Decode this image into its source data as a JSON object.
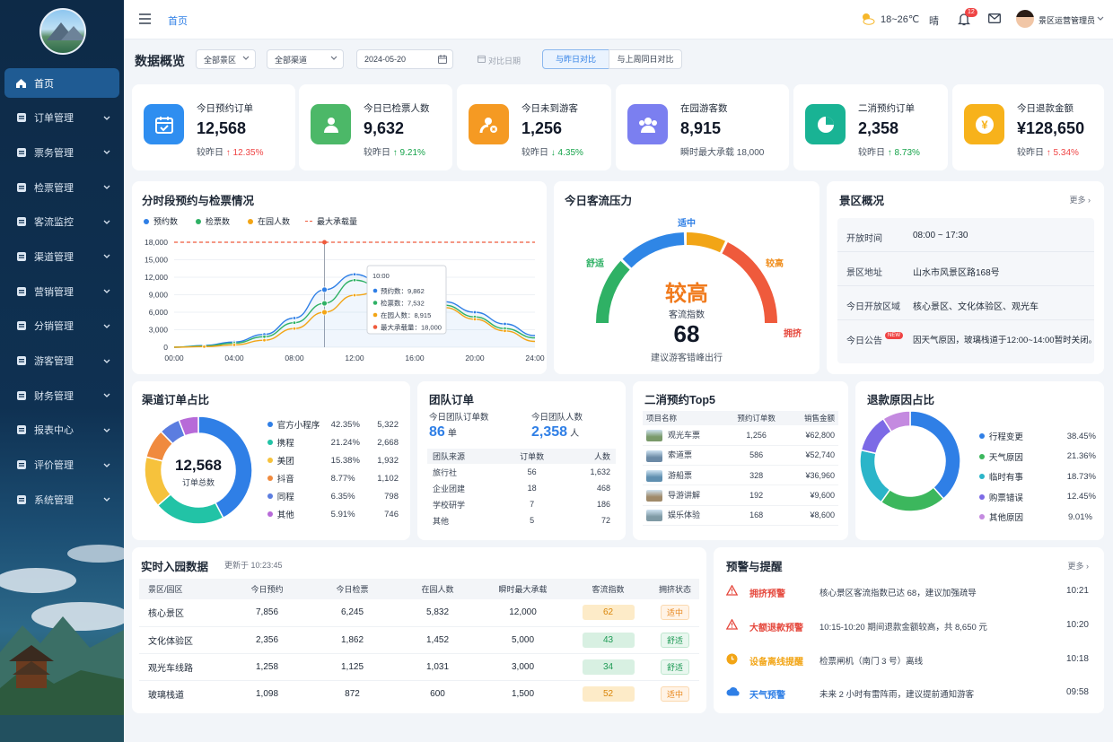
{
  "nav": {
    "items": [
      {
        "label": "首页",
        "icon": "home-icon"
      },
      {
        "label": "订单管理",
        "icon": "order-icon"
      },
      {
        "label": "票务管理",
        "icon": "ticket-icon"
      },
      {
        "label": "检票管理",
        "icon": "checkin-icon"
      },
      {
        "label": "客流监控",
        "icon": "monitor-icon"
      },
      {
        "label": "渠道管理",
        "icon": "channel-icon"
      },
      {
        "label": "营销管理",
        "icon": "marketing-icon"
      },
      {
        "label": "分销管理",
        "icon": "distribution-icon"
      },
      {
        "label": "游客管理",
        "icon": "visitor-icon"
      },
      {
        "label": "财务管理",
        "icon": "finance-icon"
      },
      {
        "label": "报表中心",
        "icon": "report-icon"
      },
      {
        "label": "评价管理",
        "icon": "review-icon"
      },
      {
        "label": "系统管理",
        "icon": "settings-icon"
      }
    ]
  },
  "topbar": {
    "breadcrumb": "首页",
    "weather_temp": "18~26℃",
    "weather_text": "晴",
    "notif_count": "12",
    "user_name": "景区运营管理员"
  },
  "filters": {
    "title": "数据概览",
    "scenic": "全部景区",
    "channel": "全部渠道",
    "date": "2024-05-20",
    "compare_date": "对比日期",
    "btn_yesterday": "与昨日对比",
    "btn_lastweek": "与上周同日对比"
  },
  "kpis": [
    {
      "label": "今日预约订单",
      "value": "12,568",
      "cmp_label": "较昨日",
      "cmp": "↑ 12.35%",
      "dir": "up",
      "color": "#2f8ef0"
    },
    {
      "label": "今日已检票人数",
      "value": "9,632",
      "cmp_label": "较昨日",
      "cmp": "↑ 9.21%",
      "dir": "dn",
      "color": "#4cb868"
    },
    {
      "label": "今日未到游客",
      "value": "1,256",
      "cmp_label": "较昨日",
      "cmp": "↓ 4.35%",
      "dir": "dn",
      "color": "#f59a23"
    },
    {
      "label": "在园游客数",
      "value": "8,915",
      "cmp_label": "瞬时最大承载",
      "cmp": "18,000",
      "dir": "none",
      "color": "#7b7ff0"
    },
    {
      "label": "二消预约订单",
      "value": "2,358",
      "cmp_label": "较昨日",
      "cmp": "↑ 8.73%",
      "dir": "dn",
      "color": "#19b394"
    },
    {
      "label": "今日退款金额",
      "value": "¥128,650",
      "cmp_label": "较昨日",
      "cmp": "↑ 5.34%",
      "dir": "up",
      "color": "#f7b21b"
    }
  ],
  "hourly": {
    "title": "分时段预约与检票情况",
    "legend": [
      "预约数",
      "检票数",
      "在园人数",
      "最大承载量"
    ],
    "tooltip": {
      "time": "10:00",
      "rows": [
        "预约数：9,862",
        "检票数：7,532",
        "在园人数：8,915",
        "最大承载量：18,000"
      ]
    }
  },
  "chart_data": {
    "type": "line",
    "x": [
      "00:00",
      "02:00",
      "04:00",
      "06:00",
      "08:00",
      "10:00",
      "12:00",
      "14:00",
      "16:00",
      "18:00",
      "20:00",
      "22:00",
      "24:00"
    ],
    "series": [
      {
        "name": "预约数",
        "values": [
          0,
          300,
          900,
          2200,
          5000,
          9862,
          12500,
          10800,
          9000,
          7800,
          6000,
          4000,
          2000
        ]
      },
      {
        "name": "检票数",
        "values": [
          0,
          200,
          700,
          1800,
          4200,
          7532,
          11500,
          10000,
          8200,
          7200,
          5200,
          3200,
          1600
        ]
      },
      {
        "name": "在园人数",
        "values": [
          0,
          100,
          400,
          1200,
          3200,
          6000,
          8915,
          9800,
          8200,
          6800,
          4800,
          2800,
          1000
        ]
      },
      {
        "name": "最大承载量",
        "values": [
          18000,
          18000,
          18000,
          18000,
          18000,
          18000,
          18000,
          18000,
          18000,
          18000,
          18000,
          18000,
          18000
        ]
      }
    ],
    "yticks": [
      "18,000",
      "15,000",
      "12,000",
      "9,000",
      "6,000",
      "3,000",
      "0"
    ],
    "xticks": [
      "00:00",
      "04:00",
      "08:00",
      "12:00",
      "16:00",
      "20:00",
      "24:00"
    ],
    "ylim": [
      0,
      18000
    ]
  },
  "pressure": {
    "title": "今日客流压力",
    "label_top": "适中",
    "label_left": "舒适",
    "label_right": "较高",
    "label_right2": "拥挤",
    "level": "较高",
    "index_label": "客流指数",
    "index": "68",
    "index_value": 68,
    "hint": "建议游客错峰出行"
  },
  "overview": {
    "title": "景区概况",
    "more": "更多",
    "rows": [
      {
        "k": "开放时间",
        "v": "08:00 ~ 17:30"
      },
      {
        "k": "景区地址",
        "v": "山水市风景区路168号"
      },
      {
        "k": "今日开放区域",
        "v": "核心景区、文化体验区、观光车"
      },
      {
        "k": "今日公告",
        "badge": "NEW",
        "v": "因天气原因，玻璃栈道于12:00~14:00暂时关闭。"
      }
    ]
  },
  "channel": {
    "title": "渠道订单占比",
    "total": "12,568",
    "total_label": "订单总数",
    "items": [
      {
        "name": "官方小程序",
        "pct": "42.35%",
        "count": "5,322",
        "value": 42.35,
        "color": "#2f7fe6"
      },
      {
        "name": "携程",
        "pct": "21.24%",
        "count": "2,668",
        "value": 21.24,
        "color": "#22c3a6"
      },
      {
        "name": "美团",
        "pct": "15.38%",
        "count": "1,932",
        "value": 15.38,
        "color": "#f6c23c"
      },
      {
        "name": "抖音",
        "pct": "8.77%",
        "count": "1,102",
        "value": 8.77,
        "color": "#f08a3e"
      },
      {
        "name": "同程",
        "pct": "6.35%",
        "count": "798",
        "value": 6.35,
        "color": "#5b7de0"
      },
      {
        "name": "其他",
        "pct": "5.91%",
        "count": "746",
        "value": 5.91,
        "color": "#b76ad8"
      }
    ]
  },
  "group": {
    "title": "团队订单",
    "order_label": "今日团队订单数",
    "order_value": "86",
    "order_unit": "单",
    "people_label": "今日团队人数",
    "people_value": "2,358",
    "people_unit": "人",
    "headers": [
      "团队来源",
      "订单数",
      "人数"
    ],
    "rows": [
      [
        "旅行社",
        "56",
        "1,632"
      ],
      [
        "企业团建",
        "18",
        "468"
      ],
      [
        "学校研学",
        "7",
        "186"
      ],
      [
        "其他",
        "5",
        "72"
      ]
    ]
  },
  "top5": {
    "title": "二消预约Top5",
    "headers": [
      "项目名称",
      "预约订单数",
      "销售金额"
    ],
    "rows": [
      [
        "观光车票",
        "1,256",
        "¥62,800"
      ],
      [
        "索道票",
        "586",
        "¥52,740"
      ],
      [
        "游船票",
        "328",
        "¥36,960"
      ],
      [
        "导游讲解",
        "192",
        "¥9,600"
      ],
      [
        "娱乐体验",
        "168",
        "¥8,600"
      ]
    ]
  },
  "refund": {
    "title": "退款原因占比",
    "items": [
      {
        "name": "行程变更",
        "pct": "38.45%",
        "value": 38.45,
        "color": "#2f7fe6"
      },
      {
        "name": "天气原因",
        "pct": "21.36%",
        "value": 21.36,
        "color": "#3cb75d"
      },
      {
        "name": "临时有事",
        "pct": "18.73%",
        "value": 18.73,
        "color": "#2bb5c9"
      },
      {
        "name": "购票错误",
        "pct": "12.45%",
        "value": 12.45,
        "color": "#7c6ae6"
      },
      {
        "name": "其他原因",
        "pct": "9.01%",
        "value": 9.01,
        "color": "#c48ae0"
      }
    ]
  },
  "realtime": {
    "title": "实时入园数据",
    "updated": "更新于 10:23:45",
    "headers": [
      "景区/园区",
      "今日预约",
      "今日检票",
      "在园人数",
      "瞬时最大承载",
      "客流指数",
      "拥挤状态"
    ],
    "rows": [
      {
        "c": [
          "核心景区",
          "7,856",
          "6,245",
          "5,832",
          "12,000"
        ],
        "idx": "62",
        "status": "适中",
        "level": "mid"
      },
      {
        "c": [
          "文化体验区",
          "2,356",
          "1,862",
          "1,452",
          "5,000"
        ],
        "idx": "43",
        "status": "舒适",
        "level": "ok"
      },
      {
        "c": [
          "观光车线路",
          "1,258",
          "1,125",
          "1,031",
          "3,000"
        ],
        "idx": "34",
        "status": "舒适",
        "level": "ok"
      },
      {
        "c": [
          "玻璃栈道",
          "1,098",
          "872",
          "600",
          "1,500"
        ],
        "idx": "52",
        "status": "适中",
        "level": "mid"
      }
    ]
  },
  "alerts": {
    "title": "预警与提醒",
    "more": "更多",
    "items": [
      {
        "type": "拥挤预警",
        "msg": "核心景区客流指数已达 68，建议加强疏导",
        "time": "10:21",
        "color": "#e5483d",
        "icon": "warning-icon"
      },
      {
        "type": "大额退款预警",
        "msg": "10:15-10:20 期间退款金额较高，共 8,650 元",
        "time": "10:20",
        "color": "#e5483d",
        "icon": "warning-icon"
      },
      {
        "type": "设备离线提醒",
        "msg": "检票闸机（南门 3 号）离线",
        "time": "10:18",
        "color": "#f2a516",
        "icon": "clock-icon"
      },
      {
        "type": "天气预警",
        "msg": "未来 2 小时有雷阵雨，建议提前通知游客",
        "time": "09:58",
        "color": "#2f7fe6",
        "icon": "cloud-icon"
      }
    ]
  }
}
